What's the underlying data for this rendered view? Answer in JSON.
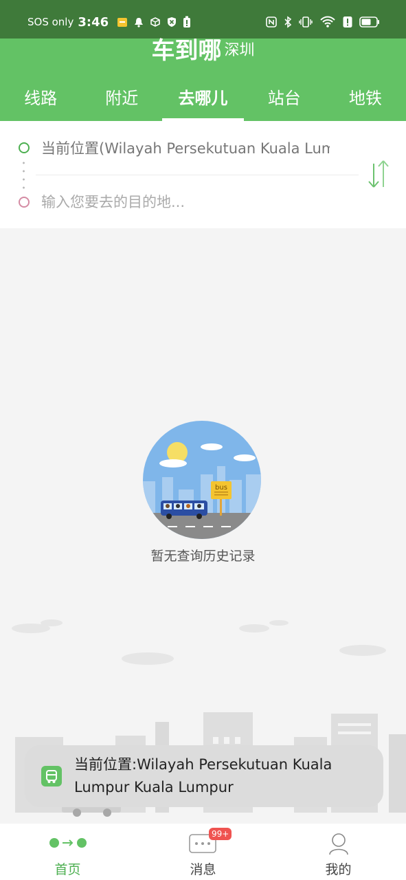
{
  "status_bar": {
    "carrier": "SOS only",
    "time": "3:46"
  },
  "header": {
    "title": "车到哪",
    "city": "深圳",
    "tabs": [
      {
        "label": "线路",
        "active": false
      },
      {
        "label": "附近",
        "active": false
      },
      {
        "label": "去哪儿",
        "active": true
      },
      {
        "label": "站台",
        "active": false
      },
      {
        "label": "地铁",
        "active": false
      }
    ]
  },
  "route": {
    "from": "当前位置(Wilayah Persekutuan Kuala Lumpur Kuala Lumpur)",
    "to_placeholder": "输入您要去的目的地..."
  },
  "empty": {
    "message": "暂无查询历史记录",
    "sign_text": "bus"
  },
  "toast": {
    "message": "当前位置:Wilayah Persekutuan Kuala Lumpur Kuala Lumpur"
  },
  "bottom_nav": {
    "items": [
      {
        "label": "首页",
        "icon": "route-icon",
        "active": true
      },
      {
        "label": "消息",
        "icon": "message-icon",
        "active": false
      },
      {
        "label": "我的",
        "icon": "profile-icon",
        "active": false
      }
    ],
    "badge": "99+"
  },
  "colors": {
    "primary": "#63c265",
    "status_bar": "#3f7a3a",
    "badge": "#ef5350"
  }
}
